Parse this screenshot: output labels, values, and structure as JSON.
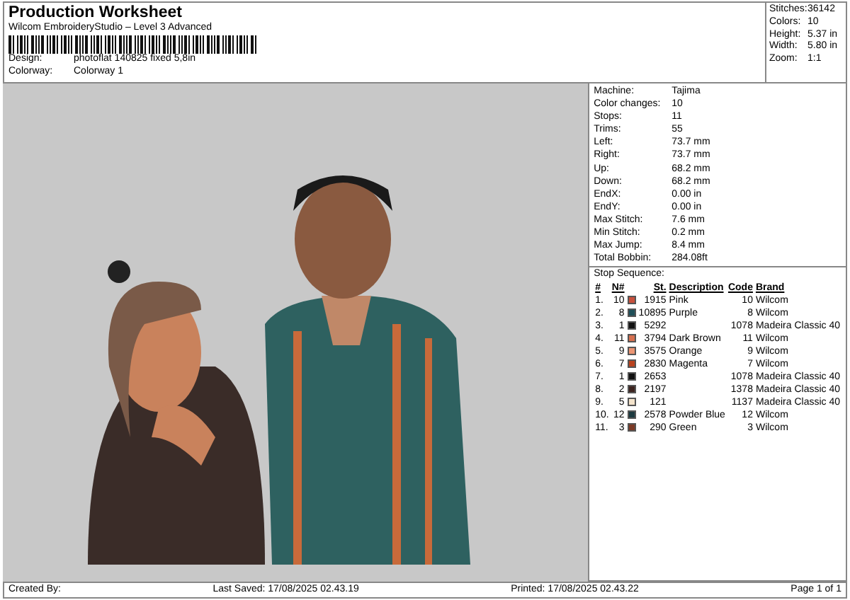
{
  "title": "Production Worksheet",
  "software": "Wilcom EmbroideryStudio – Level 3 Advanced",
  "details": [
    {
      "label": "Design:",
      "value": "photoflat 140825 fixed 5,8in"
    },
    {
      "label": "Colorway:",
      "value": "Colorway 1"
    }
  ],
  "summary": [
    {
      "label": "Stitches:",
      "value": "36142"
    },
    {
      "label": "Colors:",
      "value": "10"
    },
    {
      "label": "Height:",
      "value": "5.37 in"
    },
    {
      "label": "Width:",
      "value": "5.80 in"
    },
    {
      "label": "Zoom:",
      "value": "1:1"
    }
  ],
  "machine_info": [
    {
      "label": "Machine:",
      "value": "Tajima"
    },
    {
      "label": "Color changes:",
      "value": "10"
    },
    {
      "label": "Stops:",
      "value": "11"
    },
    {
      "label": "Trims:",
      "value": "55"
    },
    {
      "label": "Left:",
      "value": "73.7 mm"
    },
    {
      "label": "Right:",
      "value": "73.7 mm"
    },
    {
      "label": "Up:",
      "value": "68.2 mm"
    },
    {
      "label": "Down:",
      "value": "68.2 mm"
    },
    {
      "label": "EndX:",
      "value": "0.00 in"
    },
    {
      "label": "EndY:",
      "value": "0.00 in"
    },
    {
      "label": "Max Stitch:",
      "value": "7.6 mm"
    },
    {
      "label": "Min Stitch:",
      "value": "0.2 mm"
    },
    {
      "label": "Max Jump:",
      "value": "8.4 mm"
    },
    {
      "label": "Total Bobbin:",
      "value": "284.08ft"
    }
  ],
  "stop_sequence": {
    "title": "Stop Sequence:",
    "columns": [
      "#",
      "N#",
      "St.",
      "Description",
      "Code",
      "Brand"
    ],
    "rows": [
      {
        "index": "1.",
        "needle": "10",
        "color": "#c8503c",
        "stitches": "1915",
        "description": "Pink",
        "code": "10",
        "brand": "Wilcom"
      },
      {
        "index": "2.",
        "needle": "8",
        "color": "#1f4f58",
        "stitches": "10895",
        "description": "Purple",
        "code": "8",
        "brand": "Wilcom"
      },
      {
        "index": "3.",
        "needle": "1",
        "color": "#111111",
        "stitches": "5292",
        "code": "1078",
        "brand": "Madeira Classic 40"
      },
      {
        "index": "4.",
        "needle": "11",
        "color": "#d6704f",
        "stitches": "3794",
        "description": "Dark Brown",
        "code": "11",
        "brand": "Wilcom"
      },
      {
        "index": "5.",
        "needle": "9",
        "color": "#eb9573",
        "stitches": "3575",
        "description": "Orange",
        "code": "9",
        "brand": "Wilcom"
      },
      {
        "index": "6.",
        "needle": "7",
        "color": "#b8421e",
        "stitches": "2830",
        "description": "Magenta",
        "code": "7",
        "brand": "Wilcom"
      },
      {
        "index": "7.",
        "needle": "1",
        "color": "#111111",
        "stitches": "2653",
        "code": "1078",
        "brand": "Madeira Classic 40"
      },
      {
        "index": "8.",
        "needle": "2",
        "color": "#3d2420",
        "stitches": "2197",
        "code": "1378",
        "brand": "Madeira Classic 40"
      },
      {
        "index": "9.",
        "needle": "5",
        "color": "#f4e4cc",
        "stitches": "121",
        "code": "1137",
        "brand": "Madeira Classic 40"
      },
      {
        "index": "10.",
        "needle": "12",
        "color": "#1c3a40",
        "stitches": "2578",
        "description": "Powder Blue",
        "code": "12",
        "brand": "Wilcom"
      },
      {
        "index": "11.",
        "needle": "3",
        "color": "#7c3a26",
        "stitches": "290",
        "description": "Green",
        "code": "3",
        "brand": "Wilcom"
      }
    ]
  },
  "footer": {
    "created_by": "Created By:",
    "last_saved": "Last Saved: 17/08/2025 02.43.19",
    "printed": "Printed: 17/08/2025 02.43.22",
    "page": "Page 1 of 1"
  }
}
